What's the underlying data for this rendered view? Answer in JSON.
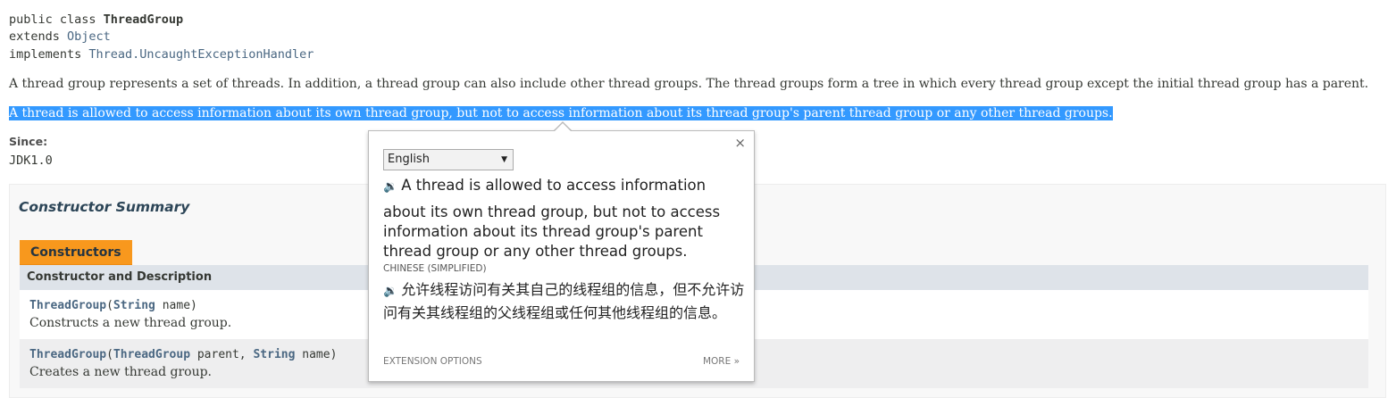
{
  "signature": {
    "line1_prefix": "public class ",
    "class_name": "ThreadGroup",
    "extends_kw": "extends ",
    "extends_type": "Object",
    "implements_kw": "implements ",
    "implements_type": "Thread.UncaughtExceptionHandler"
  },
  "description": {
    "para1": "A thread group represents a set of threads. In addition, a thread group can also include other thread groups. The thread groups form a tree in which every thread group except the initial thread group has a parent.",
    "para2_selected": "A thread is allowed to access information about its own thread group, but not to access information about its thread group's parent thread group or any other thread groups."
  },
  "since": {
    "label": "Since:",
    "value": "JDK1.0"
  },
  "constructor_summary": {
    "title": "Constructor Summary",
    "tab_label": "Constructors",
    "column_header": "Constructor and Description",
    "rows": [
      {
        "name": "ThreadGroup",
        "open": "(",
        "param1_type": "String",
        "param1_name": " name)",
        "description": "Constructs a new thread group."
      },
      {
        "name": "ThreadGroup",
        "open": "(",
        "param1_type": "ThreadGroup",
        "param1_name": " parent, ",
        "param2_type": "String",
        "param2_name": " name)",
        "description": "Creates a new thread group."
      }
    ]
  },
  "translate_popup": {
    "close": "×",
    "source_language": "English",
    "source_first_line": "A thread is allowed to access information",
    "source_rest": "about its own thread group, but not to access information about its thread group's parent thread group or any other thread groups.",
    "target_language": "CHINESE (SIMPLIFIED)",
    "translation": "允许线程访问有关其自己的线程组的信息，但不允许访问有关其线程组的父线程组或任何其他线程组的信息。",
    "extension_options": "EXTENSION OPTIONS",
    "more": "MORE »",
    "speaker_icon": "speaker-icon",
    "caret": "▼"
  },
  "colors": {
    "selection": "#3399ff",
    "tab": "#f8981d",
    "header_row": "#dee3e9",
    "link": "#4a6782"
  }
}
